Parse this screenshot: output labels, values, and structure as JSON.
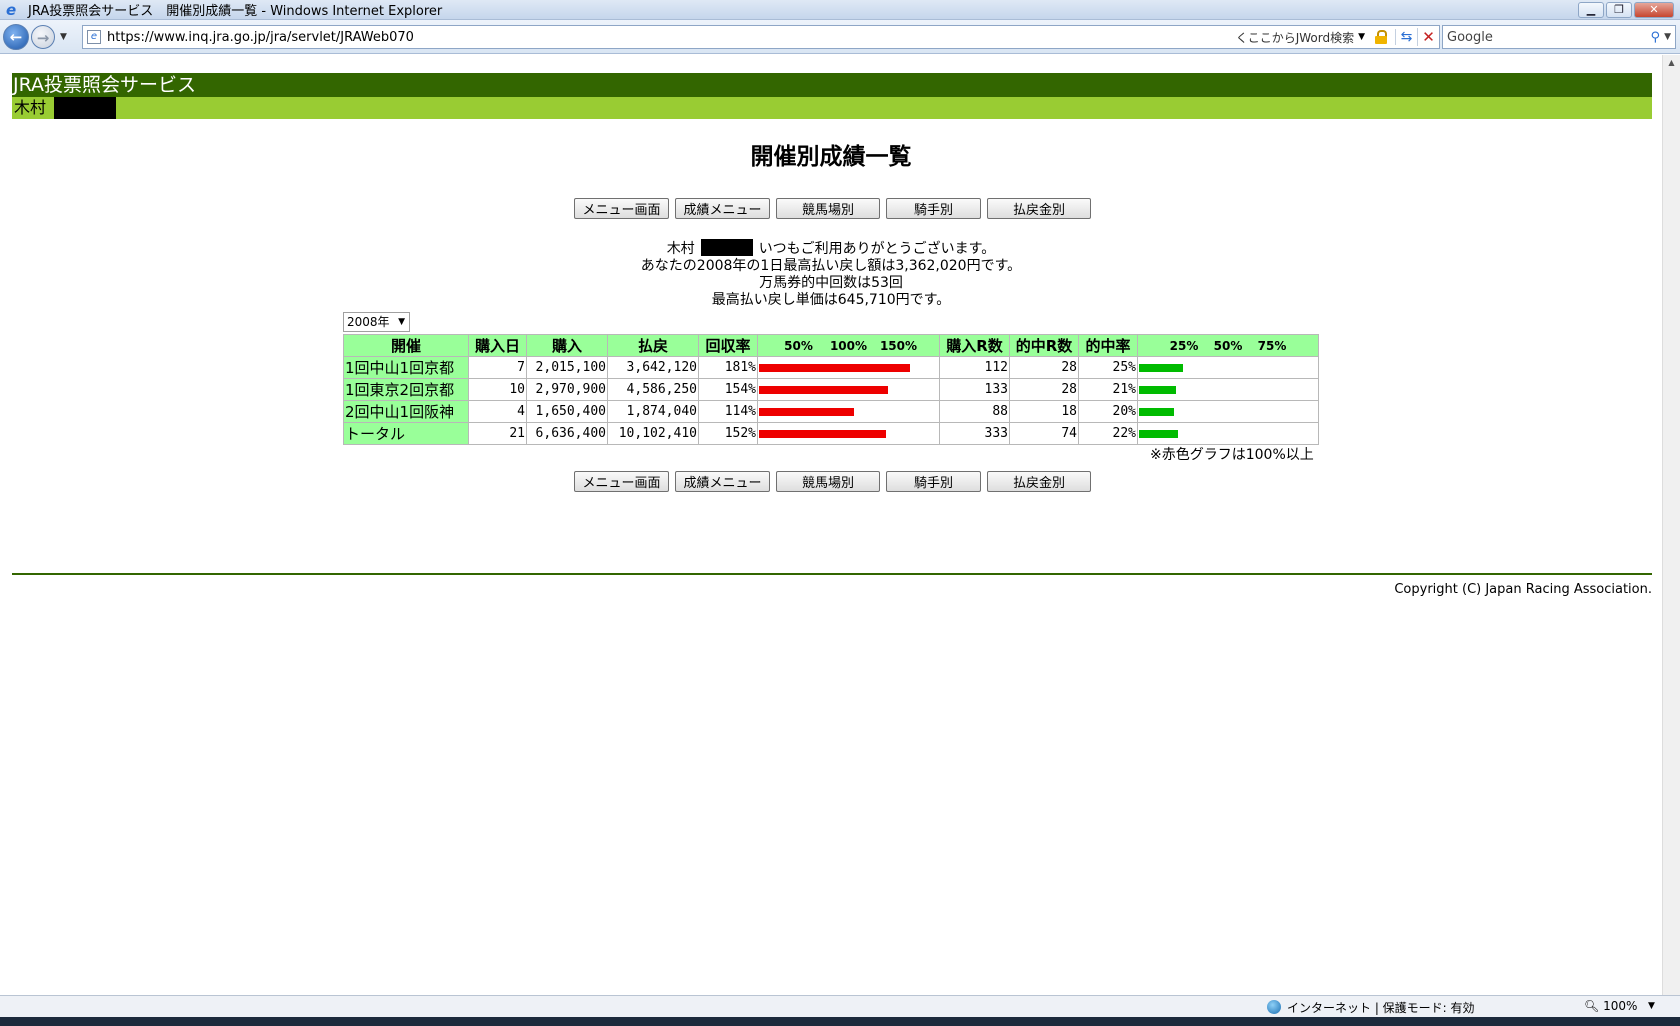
{
  "browser": {
    "window_title": "JRA投票照会サービス　開催別成績一覧 - Windows Internet Explorer",
    "url": "https://www.inq.jra.go.jp/jra/servlet/JRAWeb070",
    "jword_label": "くここからJWord検索",
    "search_placeholder": "Google",
    "status_zone": "インターネット | 保護モード: 有効",
    "zoom": "100%",
    "icons": [
      "ie-logo-icon",
      "back-arrow-icon",
      "forward-arrow-icon",
      "page-icon",
      "lock-icon",
      "refresh-icon",
      "stop-icon",
      "search-icon",
      "globe-icon",
      "zoom-icon"
    ]
  },
  "site": {
    "header": "JRA投票照会サービス",
    "user_name": "木村",
    "page_title": "開催別成績一覧"
  },
  "nav": {
    "menu": "メニュー画面",
    "results_menu": "成績メニュー",
    "by_course": "競馬場別",
    "by_jockey": "騎手別",
    "by_payout": "払戻金別"
  },
  "greeting": {
    "name": "木村",
    "line1_suffix": "いつもご利用ありがとうございます。",
    "line2": "あなたの2008年の1日最高払い戻し額は3,362,020円です。",
    "line3": "万馬券的中回数は53回",
    "line4": "最高払い戻し単価は645,710円です。"
  },
  "year_select": {
    "value": "2008年"
  },
  "table": {
    "headers": {
      "meeting": "開催",
      "days": "購入日",
      "purchase": "購入",
      "payout": "払戻",
      "return_rate": "回収率",
      "return_scale": [
        "50%",
        "100%",
        "150%"
      ],
      "races_bought": "購入R数",
      "races_hit": "的中R数",
      "hit_rate": "的中率",
      "hit_scale": [
        "25%",
        "50%",
        "75%"
      ]
    },
    "rows": [
      {
        "meeting": "1回中山1回京都",
        "days": "7",
        "purchase": "2,015,100",
        "payout": "3,642,120",
        "return_rate": "181%",
        "return_value": 181,
        "races_bought": "112",
        "races_hit": "28",
        "hit_rate": "25%",
        "hit_value": 25
      },
      {
        "meeting": "1回東京2回京都",
        "days": "10",
        "purchase": "2,970,900",
        "payout": "4,586,250",
        "return_rate": "154%",
        "return_value": 154,
        "races_bought": "133",
        "races_hit": "28",
        "hit_rate": "21%",
        "hit_value": 21
      },
      {
        "meeting": "2回中山1回阪神",
        "days": "4",
        "purchase": "1,650,400",
        "payout": "1,874,040",
        "return_rate": "114%",
        "return_value": 114,
        "races_bought": "88",
        "races_hit": "18",
        "hit_rate": "20%",
        "hit_value": 20
      },
      {
        "meeting": "トータル",
        "days": "21",
        "purchase": "6,636,400",
        "payout": "10,102,410",
        "return_rate": "152%",
        "return_value": 152,
        "races_bought": "333",
        "races_hit": "74",
        "hit_rate": "22%",
        "hit_value": 22
      }
    ],
    "note": "※赤色グラフは100%以上"
  },
  "footer": {
    "copyright": "Copyright (C) Japan Racing Association."
  },
  "colors": {
    "header_bg": "#336600",
    "userbar_bg": "#99cc33",
    "table_header_bg": "#99ff99",
    "return_bar": "#ee0000",
    "hit_bar": "#00bb00"
  }
}
